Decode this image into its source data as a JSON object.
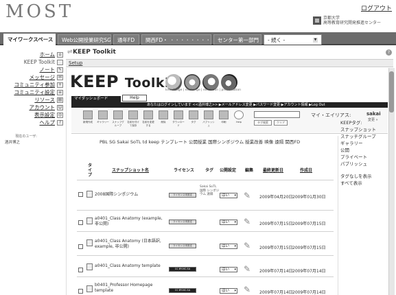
{
  "header": {
    "logo": "MOST",
    "logout": "ログアウト",
    "institution_line1": "京都大学",
    "institution_line2": "高等教育研究開発推進センター"
  },
  "tabs": [
    {
      "label": "マイワークスペース",
      "active": true
    },
    {
      "label": "Web公開授業研究SG",
      "active": false
    },
    {
      "label": "通年FD",
      "active": false
    },
    {
      "label": "関西FD・",
      "active": false
    },
    {
      "label": "センター第一部門",
      "active": false
    },
    {
      "label": "- 続く -",
      "active": false
    }
  ],
  "nav": [
    {
      "label": "ホーム",
      "icon": "home-icon"
    },
    {
      "label": "KEEP Toolkit",
      "icon": "toolkit-icon",
      "plain": true
    },
    {
      "label": "ノート",
      "icon": "note-icon"
    },
    {
      "label": "メッセージ",
      "icon": "message-icon"
    },
    {
      "label": "コミュニティ参加",
      "icon": "community-icon"
    },
    {
      "label": "コミュニティ設定",
      "icon": "settings-icon"
    },
    {
      "label": "リソース",
      "icon": "resource-icon"
    },
    {
      "label": "アカウント",
      "icon": "account-icon"
    },
    {
      "label": "表示設定",
      "icon": "display-icon"
    },
    {
      "label": "ヘルプ",
      "icon": "help-icon"
    }
  ],
  "nav_sub": "現在のユーザ:",
  "nav_user": "酒井博之",
  "panel": {
    "title": "KEEP Toolkit",
    "setup": "Setup"
  },
  "keep": {
    "title": "KEEP",
    "toolkit": "Toolkit",
    "subtitle": "knowledge | exchange | exhibition | presentation",
    "mydash": "マイダッシュボード",
    "help_tab": "Help",
    "blackbar": "あなたはログインしています <<酒井博之>>  ▶メールアドレス変更  ▶パスワード変更  ▶アカウント情報  ▶Log Out"
  },
  "tools": [
    {
      "label": "新規作成",
      "icon": "new-icon"
    },
    {
      "label": "ギャラリー",
      "icon": "gallery-icon"
    },
    {
      "label": "スナップグループ",
      "icon": "snapgroup-icon"
    },
    {
      "label": "名前を付けて保存",
      "icon": "save-as-icon"
    },
    {
      "label": "名前を変更する",
      "icon": "rename-icon"
    },
    {
      "label": "削除",
      "icon": "delete-icon"
    },
    {
      "label": "ダウンロード",
      "icon": "download-icon"
    },
    {
      "label": "タグ",
      "icon": "tag-icon"
    },
    {
      "label": "パブリッシュ",
      "icon": "publish-icon"
    },
    {
      "label": "印刷",
      "icon": "print-icon"
    },
    {
      "label": "Help",
      "icon": "help-question-icon"
    }
  ],
  "search": {
    "tag_search": "タグ検索",
    "clear": "クリア"
  },
  "alias": {
    "label": "マイ・エイリアス:",
    "value": "sakai",
    "change": "変更 »"
  },
  "tagline": "PBL SG Sakai SoTL td keep テンプレート 公開授業 国際シンポジウム 授業改善 映像 遠隔 関西FD",
  "right": {
    "title": "KEEPタグ:",
    "items": [
      "スナップショット",
      "スナッチグループ",
      "ギャラリー",
      "公開",
      "プライベート",
      "パブリッシュ"
    ],
    "items2": [
      "タグなしを表示",
      "すべて表示"
    ]
  },
  "table": {
    "headers": {
      "type": "タイプ",
      "name": "スナップショット名",
      "license": "ライセンス",
      "tag": "タグ",
      "public": "公開設定",
      "edit": "編集",
      "updated": "最終更新日",
      "created": "作成日"
    },
    "rows": [
      {
        "name": "2008国際シンポジウム",
        "license": "ライセンス未設定",
        "license_dark": false,
        "tag": "Sakai SoTL 国際 シンポジウム 遠隔",
        "public": "はい",
        "updated": "2009年04月20日",
        "created": "2009年01月30日"
      },
      {
        "name": "a0401_Class Anatomy (example, 非公開)",
        "license": "ライセンス未設定",
        "license_dark": false,
        "tag": "",
        "public": "はい",
        "updated": "2009年07月15日",
        "created": "2009年07月15日"
      },
      {
        "name": "a0401_Class Anatomy (日本語訳, example, 非公開)",
        "license": "ライセンス未設定",
        "license_dark": false,
        "tag": "",
        "public": "はい",
        "updated": "2009年07月15日",
        "created": "2009年07月15日"
      },
      {
        "name": "a0401_Class Anatomy template",
        "license": "CC BY-NC-SA",
        "license_dark": true,
        "tag": "",
        "public": "はい",
        "updated": "2009年07月14日",
        "created": "2009年07月14日"
      },
      {
        "name": "b0401_Professor Homepage template",
        "license": "CC BY-NC-SA",
        "license_dark": true,
        "tag": "",
        "public": "はい",
        "updated": "2009年07月14日",
        "created": "2009年07月14日"
      }
    ]
  }
}
